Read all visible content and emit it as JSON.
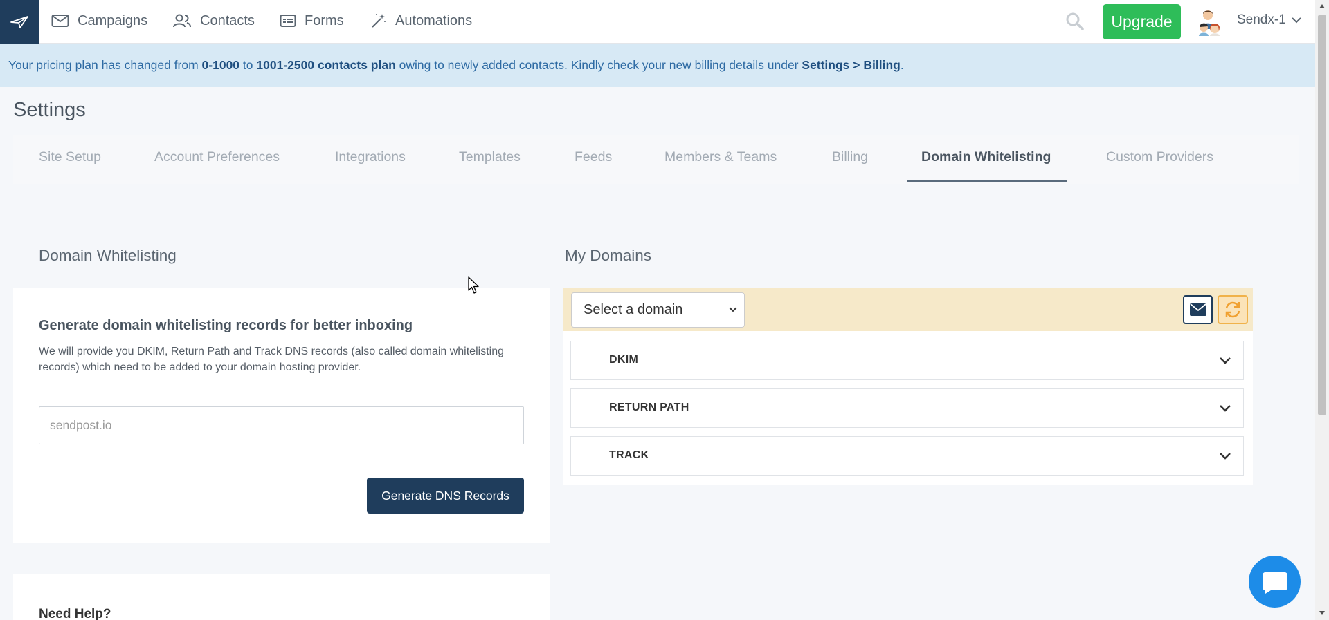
{
  "nav": {
    "items": [
      {
        "label": "Campaigns",
        "icon": "mail-icon"
      },
      {
        "label": "Contacts",
        "icon": "people-icon"
      },
      {
        "label": "Forms",
        "icon": "form-icon"
      },
      {
        "label": "Automations",
        "icon": "magic-wand-icon"
      }
    ],
    "upgrade_label": "Upgrade",
    "user_name": "Sendx-1"
  },
  "banner": {
    "prefix": "Your pricing plan has changed from ",
    "from_plan": "0-1000",
    "mid": " to ",
    "to_plan": "1001-2500 contacts plan",
    "suffix": " owing to newly added contacts. Kindly check your new billing details under ",
    "link": "Settings > Billing",
    "end": "."
  },
  "page_title": "Settings",
  "tabs": [
    {
      "label": "Site Setup"
    },
    {
      "label": "Account Preferences"
    },
    {
      "label": "Integrations"
    },
    {
      "label": "Templates"
    },
    {
      "label": "Feeds"
    },
    {
      "label": "Members & Teams"
    },
    {
      "label": "Billing"
    },
    {
      "label": "Domain Whitelisting",
      "active": true
    },
    {
      "label": "Custom Providers"
    }
  ],
  "left": {
    "section_title": "Domain Whitelisting",
    "card_heading": "Generate domain whitelisting records for better inboxing",
    "card_desc": "We will provide you DKIM, Return Path and Track DNS records (also called domain whitelisting records) which need to be added to your domain hosting provider.",
    "input_placeholder": "sendpost.io",
    "generate_label": "Generate DNS Records",
    "help_title": "Need Help?"
  },
  "right": {
    "section_title": "My Domains",
    "select_value": "Select a domain",
    "accordions": [
      {
        "label": "DKIM"
      },
      {
        "label": "RETURN PATH"
      },
      {
        "label": "TRACK"
      }
    ]
  },
  "colors": {
    "brand": "#1f3d5c",
    "upgrade": "#2ebd59",
    "banner_bg": "#d7e9f5",
    "domain_bar": "#f6e9c9",
    "chat": "#1d8ce8"
  }
}
